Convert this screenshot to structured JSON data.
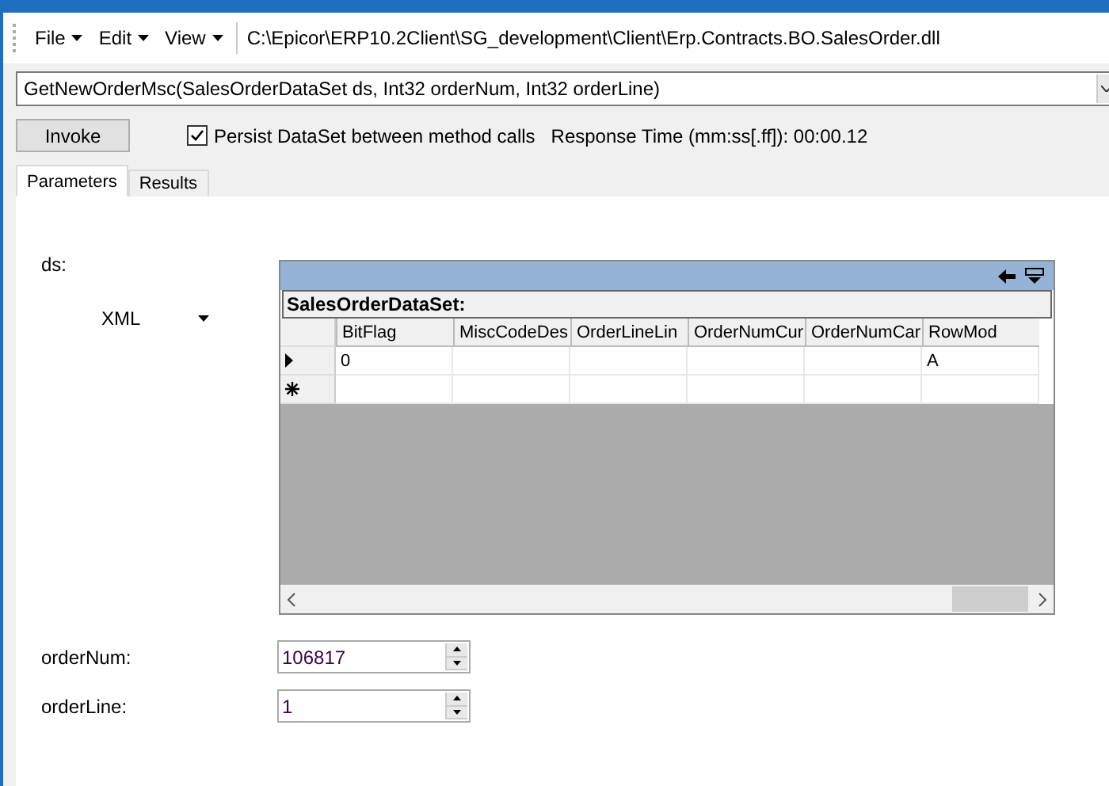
{
  "menu": [
    {
      "label": "File"
    },
    {
      "label": "Edit"
    },
    {
      "label": "View"
    }
  ],
  "path": "C:\\Epicor\\ERP10.2Client\\SG_development\\Client\\Erp.Contracts.BO.SalesOrder.dll",
  "method": "GetNewOrderMsc(SalesOrderDataSet ds, Int32 orderNum, Int32 orderLine)",
  "invoke": "Invoke",
  "persist": {
    "label": "Persist DataSet between method calls",
    "checked": true
  },
  "response_time": "Response Time (mm:ss[.ff]): 00:00.12",
  "tabs": [
    {
      "label": "Parameters",
      "selected": true
    },
    {
      "label": "Results",
      "selected": false
    }
  ],
  "ds": {
    "label": "ds:",
    "format": "XML",
    "grid": {
      "title": "SalesOrderDataSet:",
      "columns": [
        "BitFlag",
        "MiscCodeDes",
        "OrderLineLin",
        "OrderNumCur",
        "OrderNumCar",
        "RowMod"
      ],
      "rows": [
        {
          "kind": "current",
          "cells": [
            "0",
            null,
            null,
            null,
            null,
            "A"
          ]
        },
        {
          "kind": "new"
        }
      ]
    }
  },
  "fields": [
    {
      "label": "orderNum:",
      "value": "106817"
    },
    {
      "label": "orderLine:",
      "value": "1"
    }
  ]
}
